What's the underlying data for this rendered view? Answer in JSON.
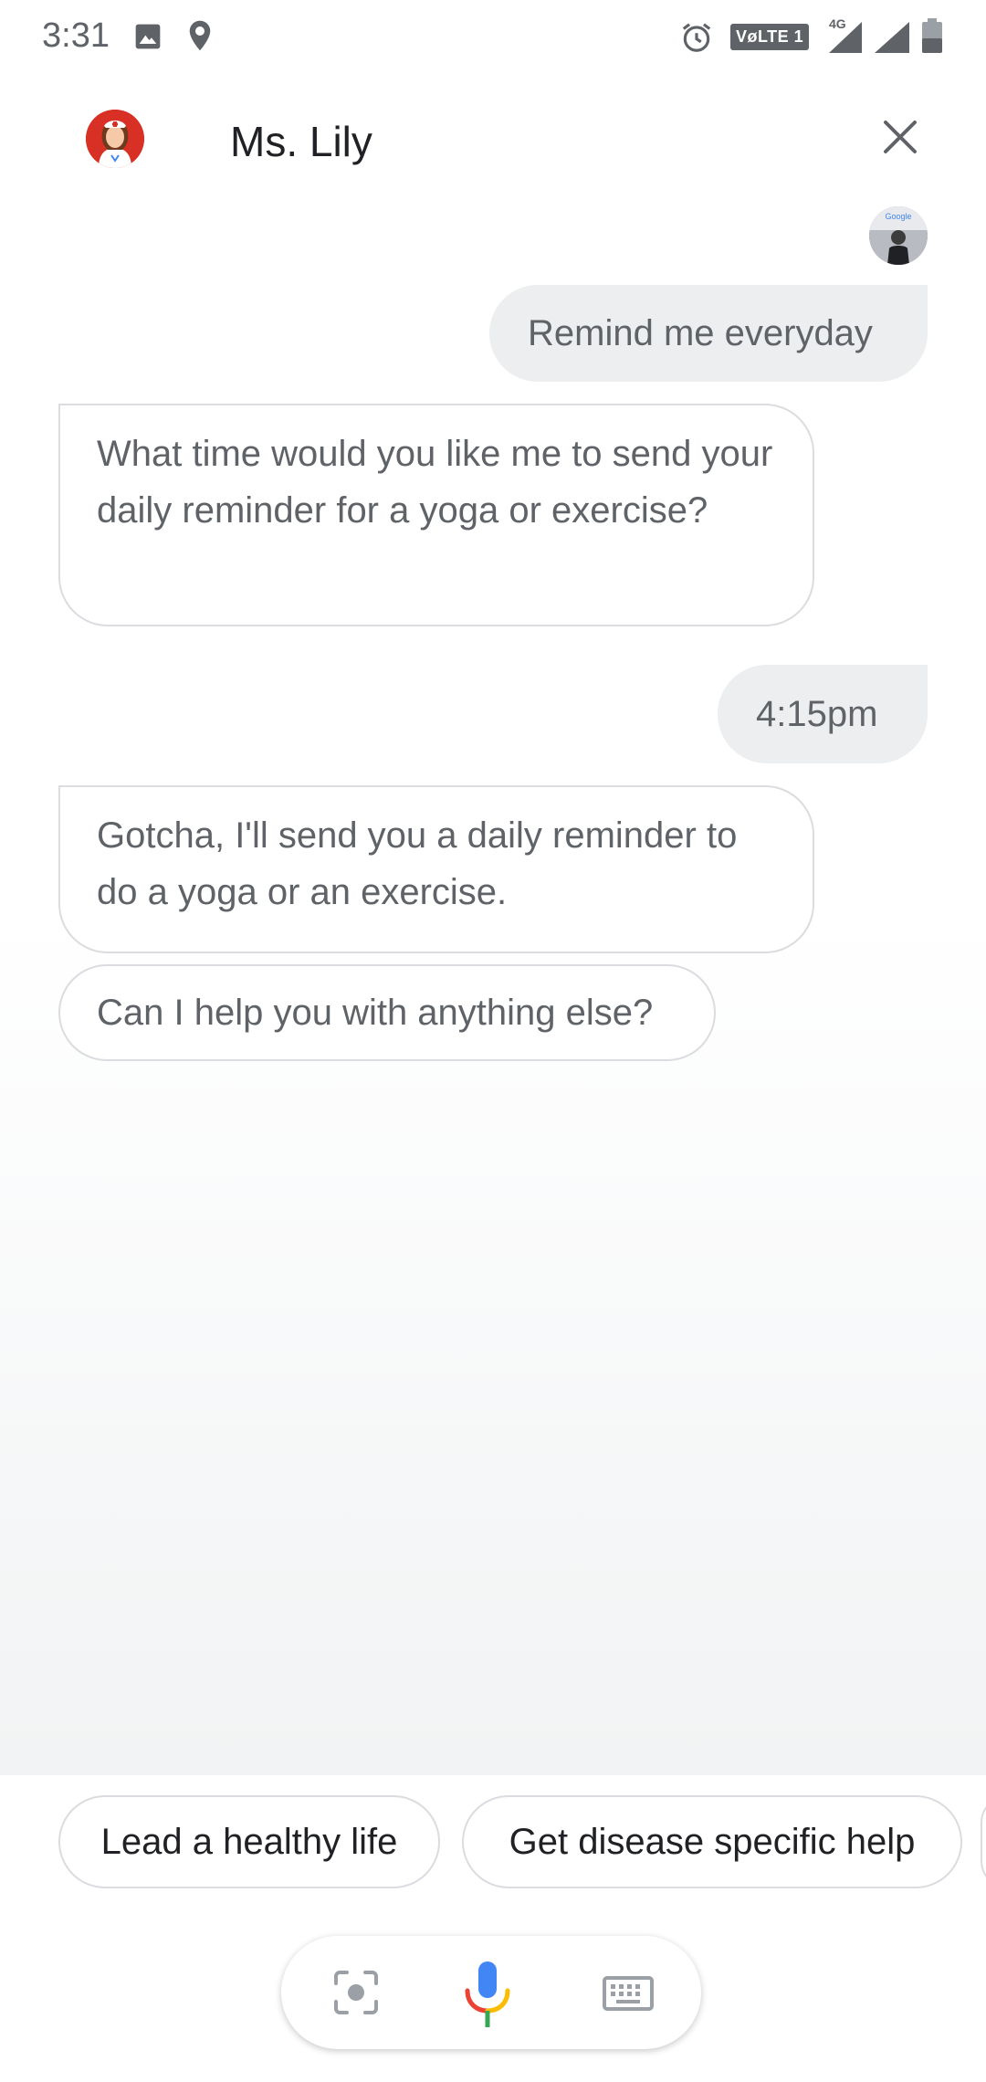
{
  "status_bar": {
    "time": "3:31",
    "volte_label": "VøLTE 1",
    "network_label": "4G",
    "icons": [
      "image-icon",
      "location-icon",
      "alarm-icon",
      "signal-icon",
      "signal-icon",
      "battery-icon"
    ]
  },
  "header": {
    "title": "Ms. Lily",
    "avatar": "nurse-avatar",
    "close_icon": "close-icon"
  },
  "conversation": {
    "messages": [
      {
        "from": "user",
        "text": "Remind me everyday"
      },
      {
        "from": "bot",
        "text": "What time would you like me to send your daily reminder for a yoga or exercise?"
      },
      {
        "from": "user",
        "text": "4:15pm"
      },
      {
        "from": "bot",
        "text": "Gotcha, I'll send you a daily reminder to do a yoga or an exercise."
      },
      {
        "from": "bot",
        "text": "Can I help you with anything else?"
      }
    ],
    "user_avatar_badge": "Google"
  },
  "suggestions": {
    "chips": [
      "Lead a healthy life",
      "Get disease specific help"
    ]
  },
  "input_bar": {
    "icons": [
      "lens-icon",
      "mic-icon",
      "keyboard-icon"
    ]
  },
  "colors": {
    "bubble_user_bg": "#eceef0",
    "bubble_border": "#dadce0",
    "text": "#5f6368",
    "mic_blue": "#4285f4",
    "mic_red": "#ea4335",
    "mic_yellow": "#fbbc04",
    "mic_green": "#34a853",
    "avatar_red": "#d93025"
  }
}
